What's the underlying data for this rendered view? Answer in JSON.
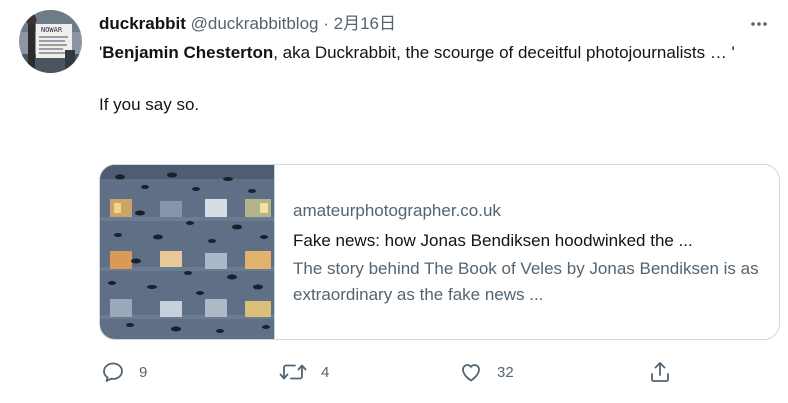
{
  "tweet": {
    "author_name": "duckrabbit",
    "handle": "@duckrabbitblog",
    "separator": "·",
    "date": "2月16日",
    "text_open_quote": "'",
    "text_bold": "Benjamin Chesterton",
    "text_after_bold": ", aka Duckrabbit, the scourge of deceitful photojournalists … '",
    "text_line2": "If you say so.",
    "avatar_sign_text": "NOWAR"
  },
  "card": {
    "domain": "amateurphotographer.co.uk",
    "title": "Fake news: how Jonas Bendiksen hoodwinked the ...",
    "description": "The story behind The Book of Veles by Jonas Bendiksen is as extraordinary as the fake news ..."
  },
  "actions": {
    "reply_count": "9",
    "retweet_count": "4",
    "like_count": "32"
  },
  "icons": {
    "more": "more-horizontal-icon",
    "reply": "reply-icon",
    "retweet": "retweet-icon",
    "like": "heart-icon",
    "share": "share-icon"
  },
  "colors": {
    "text_primary": "#0f1419",
    "text_secondary": "#536471",
    "border": "#cfd9de"
  }
}
